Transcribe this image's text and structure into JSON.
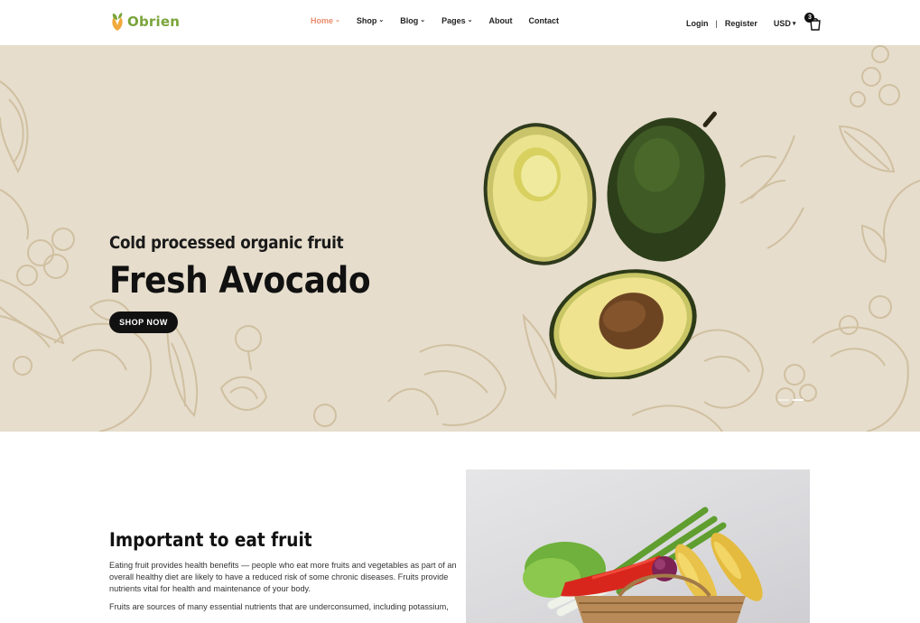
{
  "brand": {
    "name": "Obrien",
    "accent": "#7aa43a",
    "active_color": "#e98c6b"
  },
  "nav": {
    "items": [
      {
        "label": "Home",
        "has_dropdown": true,
        "active": true
      },
      {
        "label": "Shop",
        "has_dropdown": true
      },
      {
        "label": "Blog",
        "has_dropdown": true
      },
      {
        "label": "Pages",
        "has_dropdown": true
      },
      {
        "label": "About"
      },
      {
        "label": "Contact"
      }
    ]
  },
  "account": {
    "login": "Login",
    "separator": "|",
    "register": "Register",
    "currency": "USD",
    "cart_count": "3"
  },
  "hero": {
    "subtitle": "Cold processed organic fruit",
    "title": "Fresh Avocado",
    "cta": "SHOP NOW",
    "background": "#e6ddcc",
    "slides": 2
  },
  "about": {
    "title": "Important to eat fruit",
    "paragraph1": "Eating fruit provides health benefits — people who eat more fruits and vegetables as part of an overall healthy diet are likely to have a reduced risk of some chronic diseases. Fruits provide nutrients vital for health and maintenance of your body.",
    "paragraph2": "Fruits are sources of many essential nutrients that are underconsumed, including potassium,"
  },
  "icons": {
    "cart": "shopping-bag-icon",
    "chevron": "chevron-down-icon",
    "logo": "leaf-logo-icon"
  }
}
